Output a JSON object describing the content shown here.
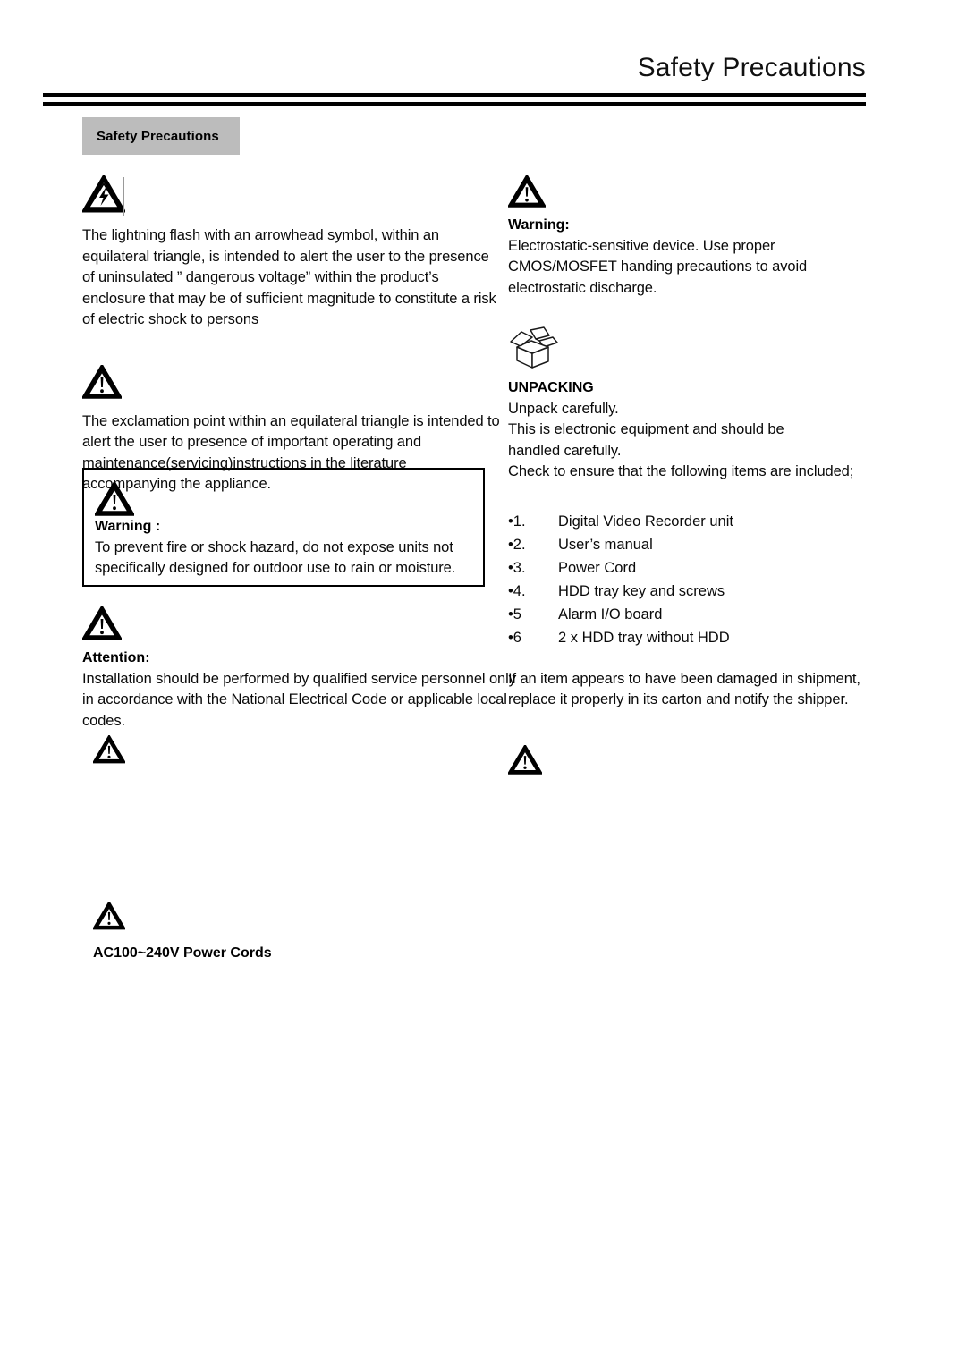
{
  "header": {
    "title": "Safety Precautions"
  },
  "section_tab": {
    "label": "Safety Precautions"
  },
  "left_column": {
    "lightning_block": {
      "icon": "lightning-bolt-triangle-icon",
      "text": "The lightning flash with an arrowhead symbol, within an equilateral triangle, is intended to alert the user to the presence of uninsulated ” dangerous voltage” within the product’s enclosure that may be of sufficient magnitude to constitute a risk of electric shock to persons"
    },
    "exclamation_block": {
      "icon": "warning-triangle-icon",
      "text": "The exclamation point within an equilateral triangle is intended to alert the user to presence of important operating and maintenance(servicing)instructions in the literature accompanying the appliance."
    },
    "warning_box": {
      "icon": "warning-triangle-icon",
      "heading": "Warning :",
      "text": "To prevent fire or shock hazard, do not expose units not specifically designed for outdoor use to rain or moisture."
    },
    "attention_block": {
      "icon": "warning-triangle-icon",
      "heading": "Attention:",
      "text": "Installation should be performed by qualified service personnel only in accordance with the National Electrical Code or applicable local codes."
    },
    "orphan_icon_block": {
      "icon": "warning-triangle-icon"
    },
    "power_cords_block": {
      "icon": "warning-triangle-icon",
      "heading": "AC100~240V Power Cords"
    }
  },
  "right_column": {
    "esd_block": {
      "icon": "warning-triangle-icon",
      "heading": "Warning:",
      "text": "Electrostatic-sensitive device. Use proper CMOS/MOSFET handing precautions to avoid electrostatic discharge."
    },
    "unpacking_block": {
      "icon": "open-box-icon",
      "heading": "UNPACKING",
      "lines": [
        "Unpack carefully.",
        "This is electronic equipment and should be",
        "handled carefully.",
        "Check to ensure that the following items are included;"
      ]
    },
    "items": [
      {
        "num": "•1.",
        "label": "Digital Video Recorder unit"
      },
      {
        "num": "•2.",
        "label": "User’s manual"
      },
      {
        "num": "•3.",
        "label": "Power Cord"
      },
      {
        "num": "•4.",
        "label": "HDD tray key and screws"
      },
      {
        "num": "•5",
        "label": "Alarm I/O board"
      },
      {
        "num": "•6",
        "label": "2 x HDD tray without HDD"
      }
    ],
    "damage_note": "If an item appears to have been damaged in shipment, replace it properly in its carton and notify the shipper.",
    "trailing_icon_block": {
      "icon": "warning-triangle-icon"
    }
  },
  "colors": {
    "tab_background": "#bcbcbc",
    "text": "#0a0a0a",
    "rule": "#000000"
  }
}
